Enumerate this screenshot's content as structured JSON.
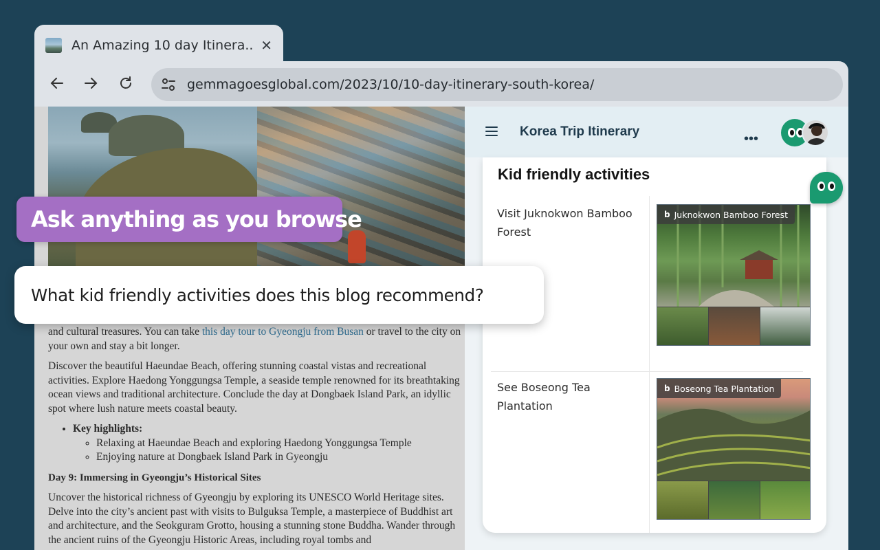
{
  "browser": {
    "tab_title": "An Amazing 10 day Itinera...",
    "url": "gemmagoesglobal.com/2023/10/10-day-itinerary-south-korea/",
    "icons": [
      "back-icon",
      "forward-icon",
      "reload-icon",
      "site-settings-icon",
      "close-icon"
    ]
  },
  "article": {
    "para1_before_link": "and cultural treasures. You can take ",
    "para1_link": "this day tour to Gyeongju from Busan",
    "para1_after_link": " or travel to the city on your own and stay a bit longer.",
    "para2": "Discover the beautiful Haeundae Beach, offering stunning coastal vistas and recreational activities. Explore Haedong Yonggungsa Temple, a seaside temple renowned for its breathtaking ocean views and traditional architecture. Conclude the day at Dongbaek Island Park, an idyllic spot where lush nature meets coastal beauty.",
    "highlights_label": "Key highlights:",
    "highlights": [
      "Relaxing at Haeundae Beach and exploring Haedong Yonggungsa Temple",
      "Enjoying nature at Dongbaek Island Park in Gyeongju"
    ],
    "day9_heading": "Day 9: Immersing in Gyeongju’s Historical Sites",
    "para3": "Uncover the historical richness of Gyeongju by exploring its UNESCO World Heritage sites. Delve into the city’s ancient past with visits to Bulguksa Temple, a masterpiece of Buddhist art and architecture, and the Seokguram Grotto, housing a stunning stone Buddha. Wander through the ancient ruins of the Gyeongju Historic Areas, including royal tombs and"
  },
  "panel": {
    "title": "Korea Trip Itinerary",
    "more_label": "•••",
    "card_title": "Kid friendly activities",
    "activities": [
      {
        "label": "Visit Juknokwon Bamboo Forest",
        "image_tag": "Juknokwon Bamboo Forest"
      },
      {
        "label": "See Boseong Tea Plantation",
        "image_tag": "Boseong Tea Plantation"
      }
    ],
    "tag_prefix": "b"
  },
  "overlay": {
    "banner": "Ask anything as you browse",
    "question": "What kid friendly activities does this blog recommend?"
  },
  "colors": {
    "background": "#1d4256",
    "banner": "#a46fc4",
    "bot_avatar": "#1a9a70",
    "link": "#2f6c8f"
  }
}
